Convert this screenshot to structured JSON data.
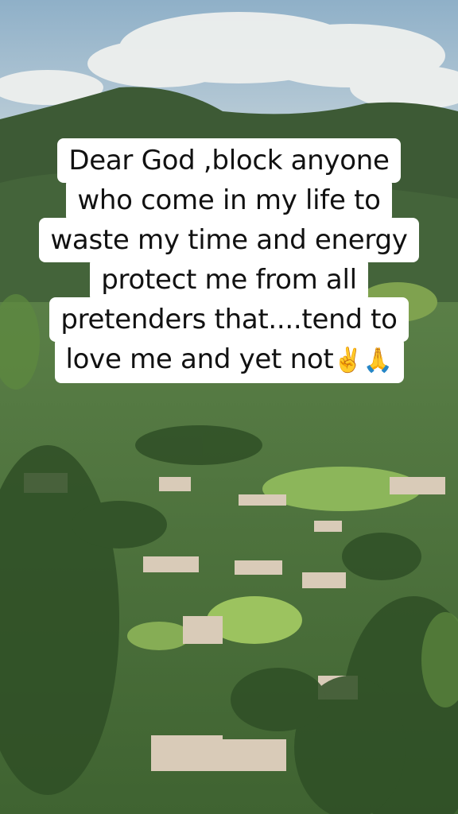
{
  "caption": {
    "lines": [
      "Dear God ,block anyone",
      "who come in my life to",
      "waste my time and energy",
      "protect me from all",
      "pretenders that....tend to",
      "love me and yet not"
    ],
    "emojis": [
      "✌️",
      "🙏"
    ]
  },
  "colors": {
    "sky_top": "#9db7cc",
    "clouds": "#eef0ee",
    "mountain": "#3d5a35",
    "vegetation": "#4f7a3c",
    "field": "#8cb65a",
    "caption_bg": "#ffffff",
    "caption_text": "#111111"
  },
  "icons": [
    "victory-hand-emoji",
    "folded-hands-emoji"
  ]
}
